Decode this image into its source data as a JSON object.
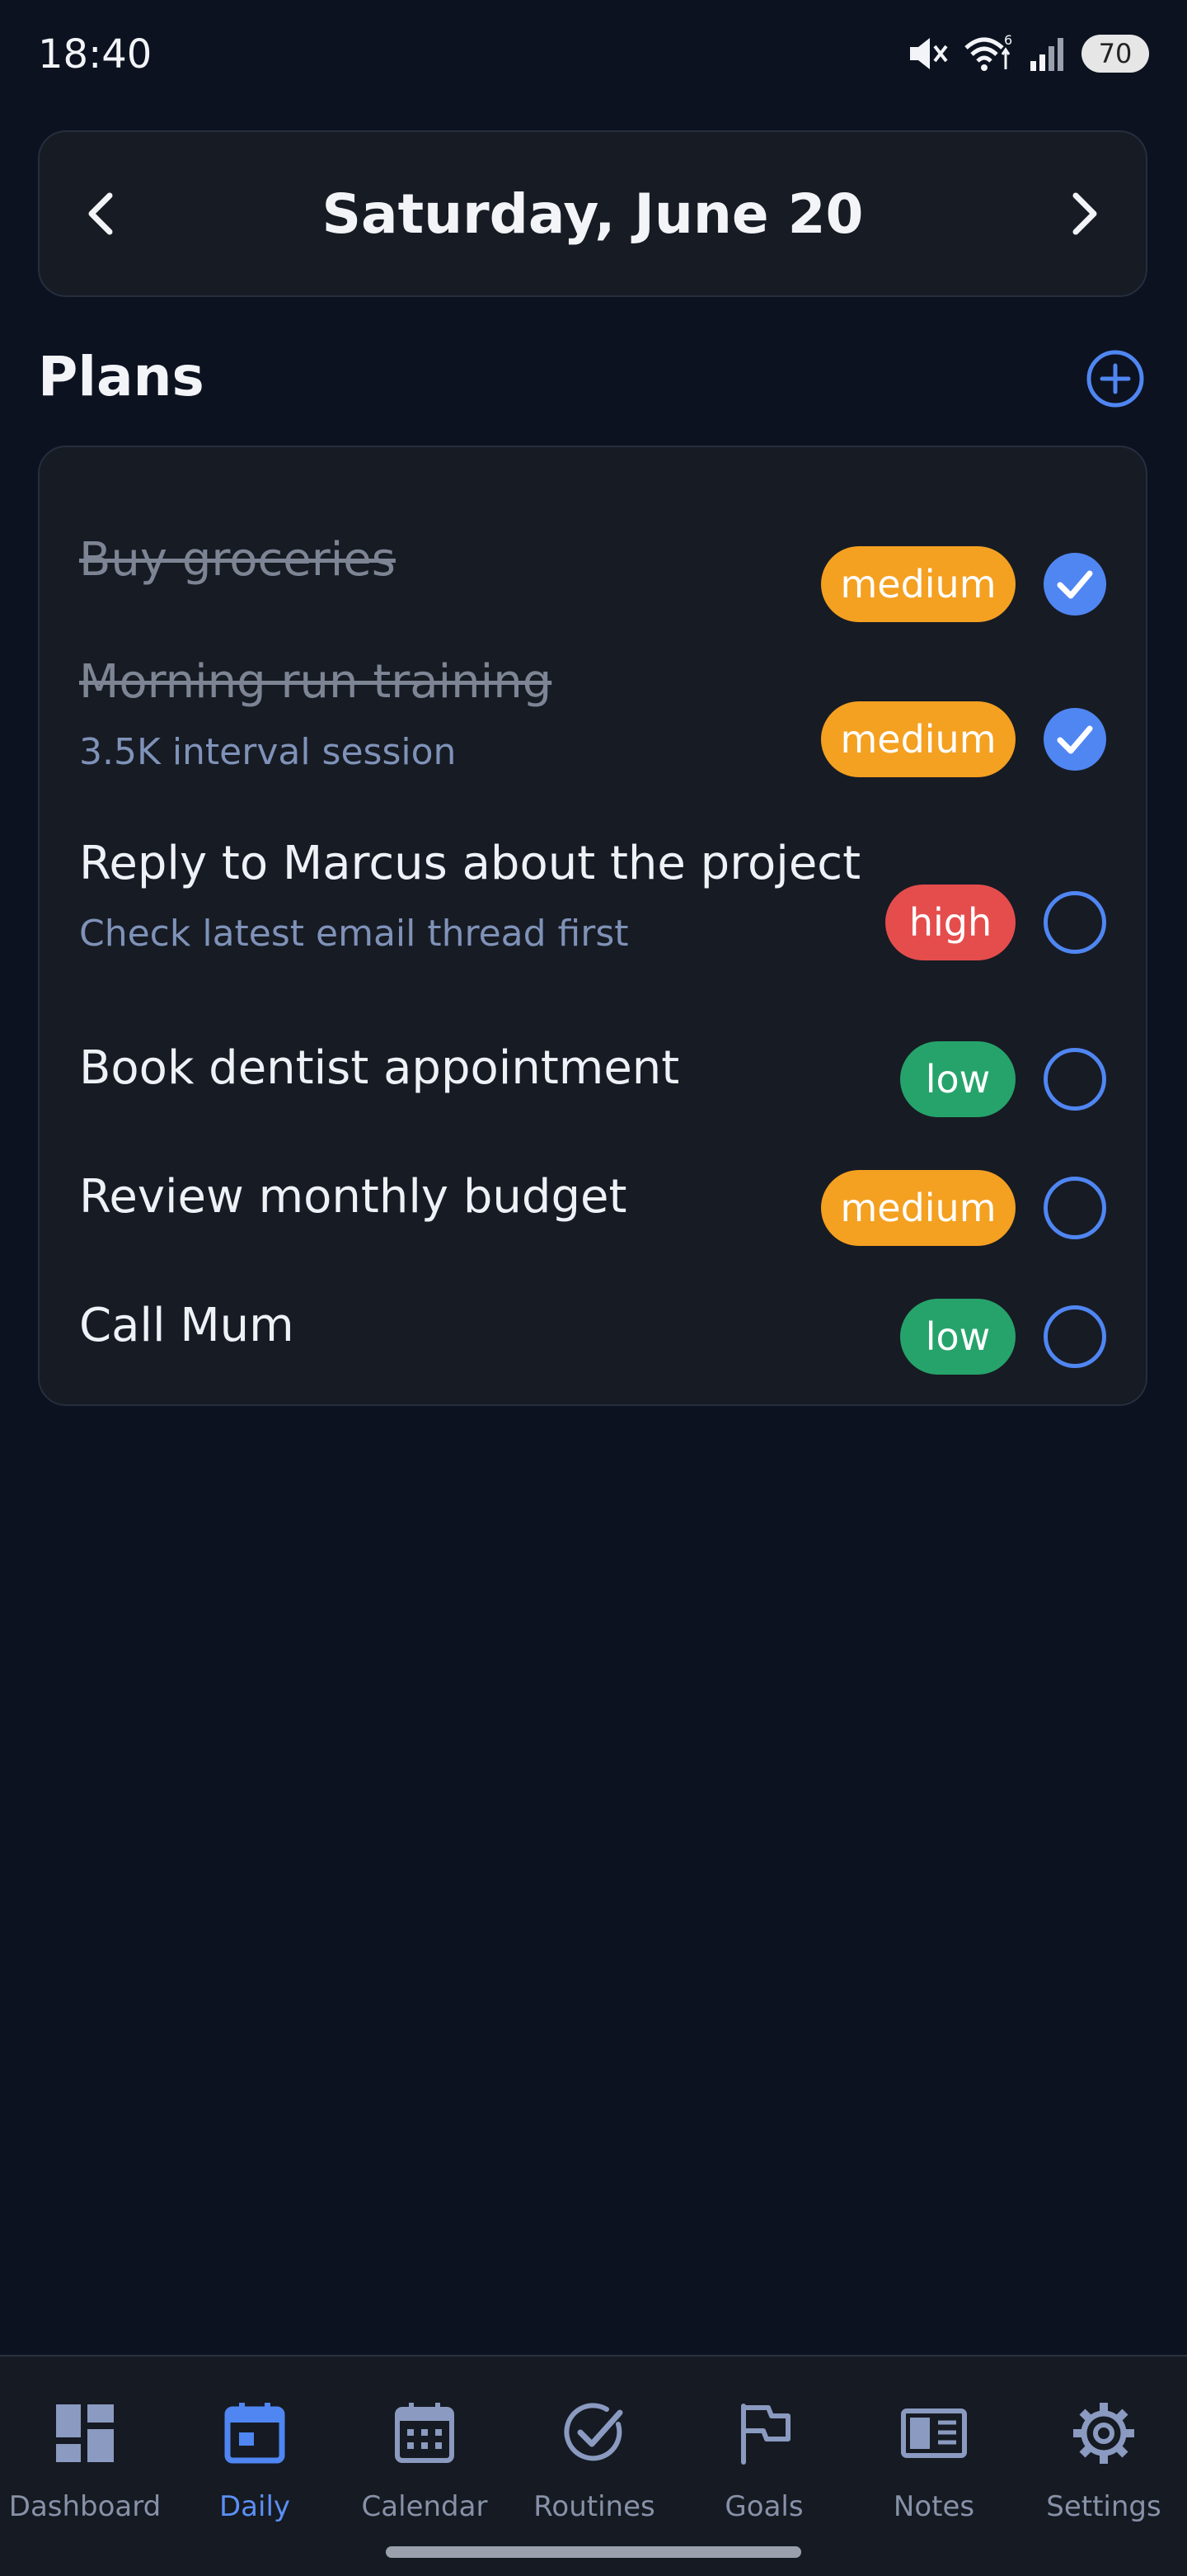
{
  "status_bar": {
    "time": "18:40",
    "battery": "70"
  },
  "date_nav": {
    "title": "Saturday, June 20"
  },
  "plans": {
    "title": "Plans",
    "items": [
      {
        "title": "Buy groceries",
        "subtitle": "",
        "priority": "medium",
        "done": true
      },
      {
        "title": "Morning run training",
        "subtitle": "3.5K interval session",
        "priority": "medium",
        "done": true
      },
      {
        "title": "Reply to Marcus about the project",
        "subtitle": "Check latest email thread first",
        "priority": "high",
        "done": false
      },
      {
        "title": "Book dentist appointment",
        "subtitle": "",
        "priority": "low",
        "done": false
      },
      {
        "title": "Review monthly budget",
        "subtitle": "",
        "priority": "medium",
        "done": false
      },
      {
        "title": "Call Mum",
        "subtitle": "",
        "priority": "low",
        "done": false
      }
    ]
  },
  "bottom_nav": {
    "items": [
      {
        "label": "Dashboard",
        "icon": "dashboard-icon",
        "active": false
      },
      {
        "label": "Daily",
        "icon": "daily-calendar-icon",
        "active": true
      },
      {
        "label": "Calendar",
        "icon": "calendar-icon",
        "active": false
      },
      {
        "label": "Routines",
        "icon": "check-circle-icon",
        "active": false
      },
      {
        "label": "Goals",
        "icon": "flag-icon",
        "active": false
      },
      {
        "label": "Notes",
        "icon": "notes-icon",
        "active": false
      },
      {
        "label": "Settings",
        "icon": "gear-icon",
        "active": false
      }
    ]
  },
  "colors": {
    "background": "#0c1220",
    "card": "#171b24",
    "accent": "#4f86f2",
    "priority_medium": "#f4a021",
    "priority_high": "#e54d4d",
    "priority_low": "#26a36b"
  }
}
